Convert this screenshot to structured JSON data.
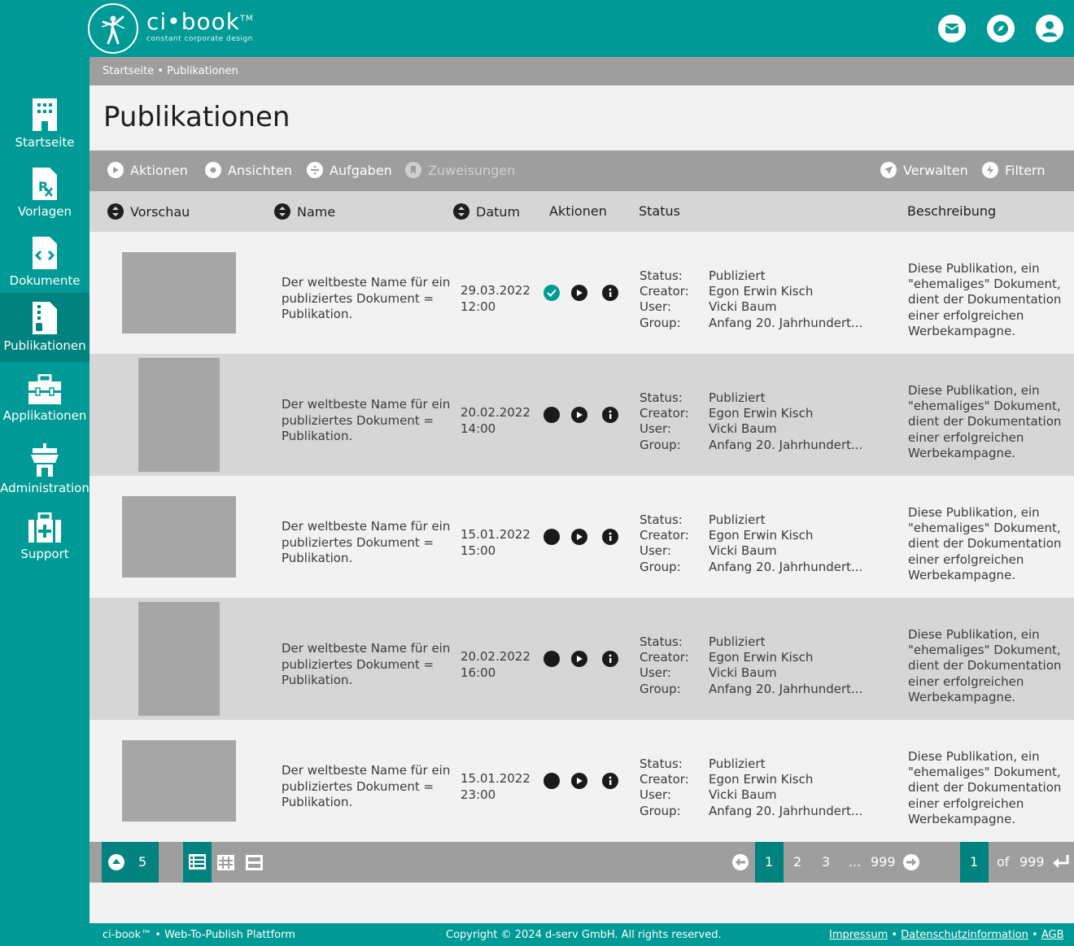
{
  "brand": {
    "name": "ci•book",
    "tm": "TM",
    "tagline": "constant corporate design"
  },
  "header_icons": [
    "mail-icon",
    "compass-icon",
    "user-icon"
  ],
  "sidebar": {
    "items": [
      {
        "label": "Startseite",
        "icon": "building-icon"
      },
      {
        "label": "Vorlagen",
        "icon": "template-icon"
      },
      {
        "label": "Dokumente",
        "icon": "code-document-icon"
      },
      {
        "label": "Publikationen",
        "icon": "publication-icon",
        "active": true
      },
      {
        "label": "Applikationen",
        "icon": "toolbox-icon"
      },
      {
        "label": "Administration",
        "icon": "tower-icon"
      },
      {
        "label": "Support",
        "icon": "first-aid-icon"
      }
    ]
  },
  "breadcrumb": "Startseite • Publikationen",
  "page_title": "Publikationen",
  "toolbar": {
    "aktionen": "Aktionen",
    "ansichten": "Ansichten",
    "aufgaben": "Aufgaben",
    "zuweisungen": "Zuweisungen",
    "verwalten": "Verwalten",
    "filtern": "Filtern"
  },
  "columns": {
    "vorschau": "Vorschau",
    "name": "Name",
    "datum": "Datum",
    "aktionen": "Aktionen",
    "status": "Status",
    "beschreibung": "Beschreibung"
  },
  "status_labels": {
    "status": "Status:",
    "creator": "Creator:",
    "user": "User:",
    "group": "Group:"
  },
  "rows": [
    {
      "name": "Der weltbeste Name für ein publiziertes Dokument = Publikation.",
      "date": "29.03.2022",
      "time": "12:00",
      "status": "Publiziert",
      "creator": "Egon Erwin Kisch",
      "user": "Vicki Baum",
      "group": "Anfang 20. Jahrhundert...",
      "description": "Diese Publikation, ein \"ehemaliges\" Dokument, dient der Dokumentation einer erfolgreichen Werbekampagne."
    },
    {
      "name": "Der weltbeste Name für ein publiziertes Dokument = Publikation.",
      "date": "20.02.2022",
      "time": "14:00",
      "status": "Publiziert",
      "creator": "Egon Erwin Kisch",
      "user": "Vicki Baum",
      "group": "Anfang 20. Jahrhundert...",
      "description": "Diese Publikation, ein \"ehemaliges\" Dokument, dient der Dokumentation einer erfolgreichen Werbekampagne."
    },
    {
      "name": "Der weltbeste Name für ein publiziertes Dokument = Publikation.",
      "date": "15.01.2022",
      "time": "15:00",
      "status": "Publiziert",
      "creator": "Egon Erwin Kisch",
      "user": "Vicki Baum",
      "group": "Anfang 20. Jahrhundert...",
      "description": "Diese Publikation, ein \"ehemaliges\" Dokument, dient der Dokumentation einer erfolgreichen Werbekampagne."
    },
    {
      "name": "Der weltbeste Name für ein publiziertes Dokument = Publikation.",
      "date": "20.02.2022",
      "time": "16:00",
      "status": "Publiziert",
      "creator": "Egon Erwin Kisch",
      "user": "Vicki Baum",
      "group": "Anfang 20. Jahrhundert...",
      "description": "Diese Publikation, ein \"ehemaliges\" Dokument, dient der Dokumentation einer erfolgreichen Werbekampagne."
    },
    {
      "name": "Der weltbeste Name für ein publiziertes Dokument = Publikation.",
      "date": "15.01.2022",
      "time": "23:00",
      "status": "Publiziert",
      "creator": "Egon Erwin Kisch",
      "user": "Vicki Baum",
      "group": "Anfang 20. Jahrhundert...",
      "description": "Diese Publikation, ein \"ehemaliges\" Dokument, dient der Dokumentation einer erfolgreichen Werbekampagne."
    }
  ],
  "pager": {
    "per_page": "5",
    "pages": [
      "1",
      "2",
      "3",
      "...",
      "999"
    ],
    "current_page": "1",
    "of_label": "of",
    "total_pages": "999"
  },
  "footer": {
    "left": "ci-book™ • Web-To-Publish Plattform",
    "copyright": "Copyright © 2024 d-serv GmbH. All rights reserved.",
    "impressum": "Impressum",
    "sep": "•",
    "datenschutz": "Datenschutzinformation",
    "agb": "AGB"
  },
  "colors": {
    "teal": "#009a96",
    "teal_dark": "#00827f",
    "gray": "#9e9e9e",
    "row_dark": "#d6d6d6",
    "row_light": "#f2f2f2"
  }
}
